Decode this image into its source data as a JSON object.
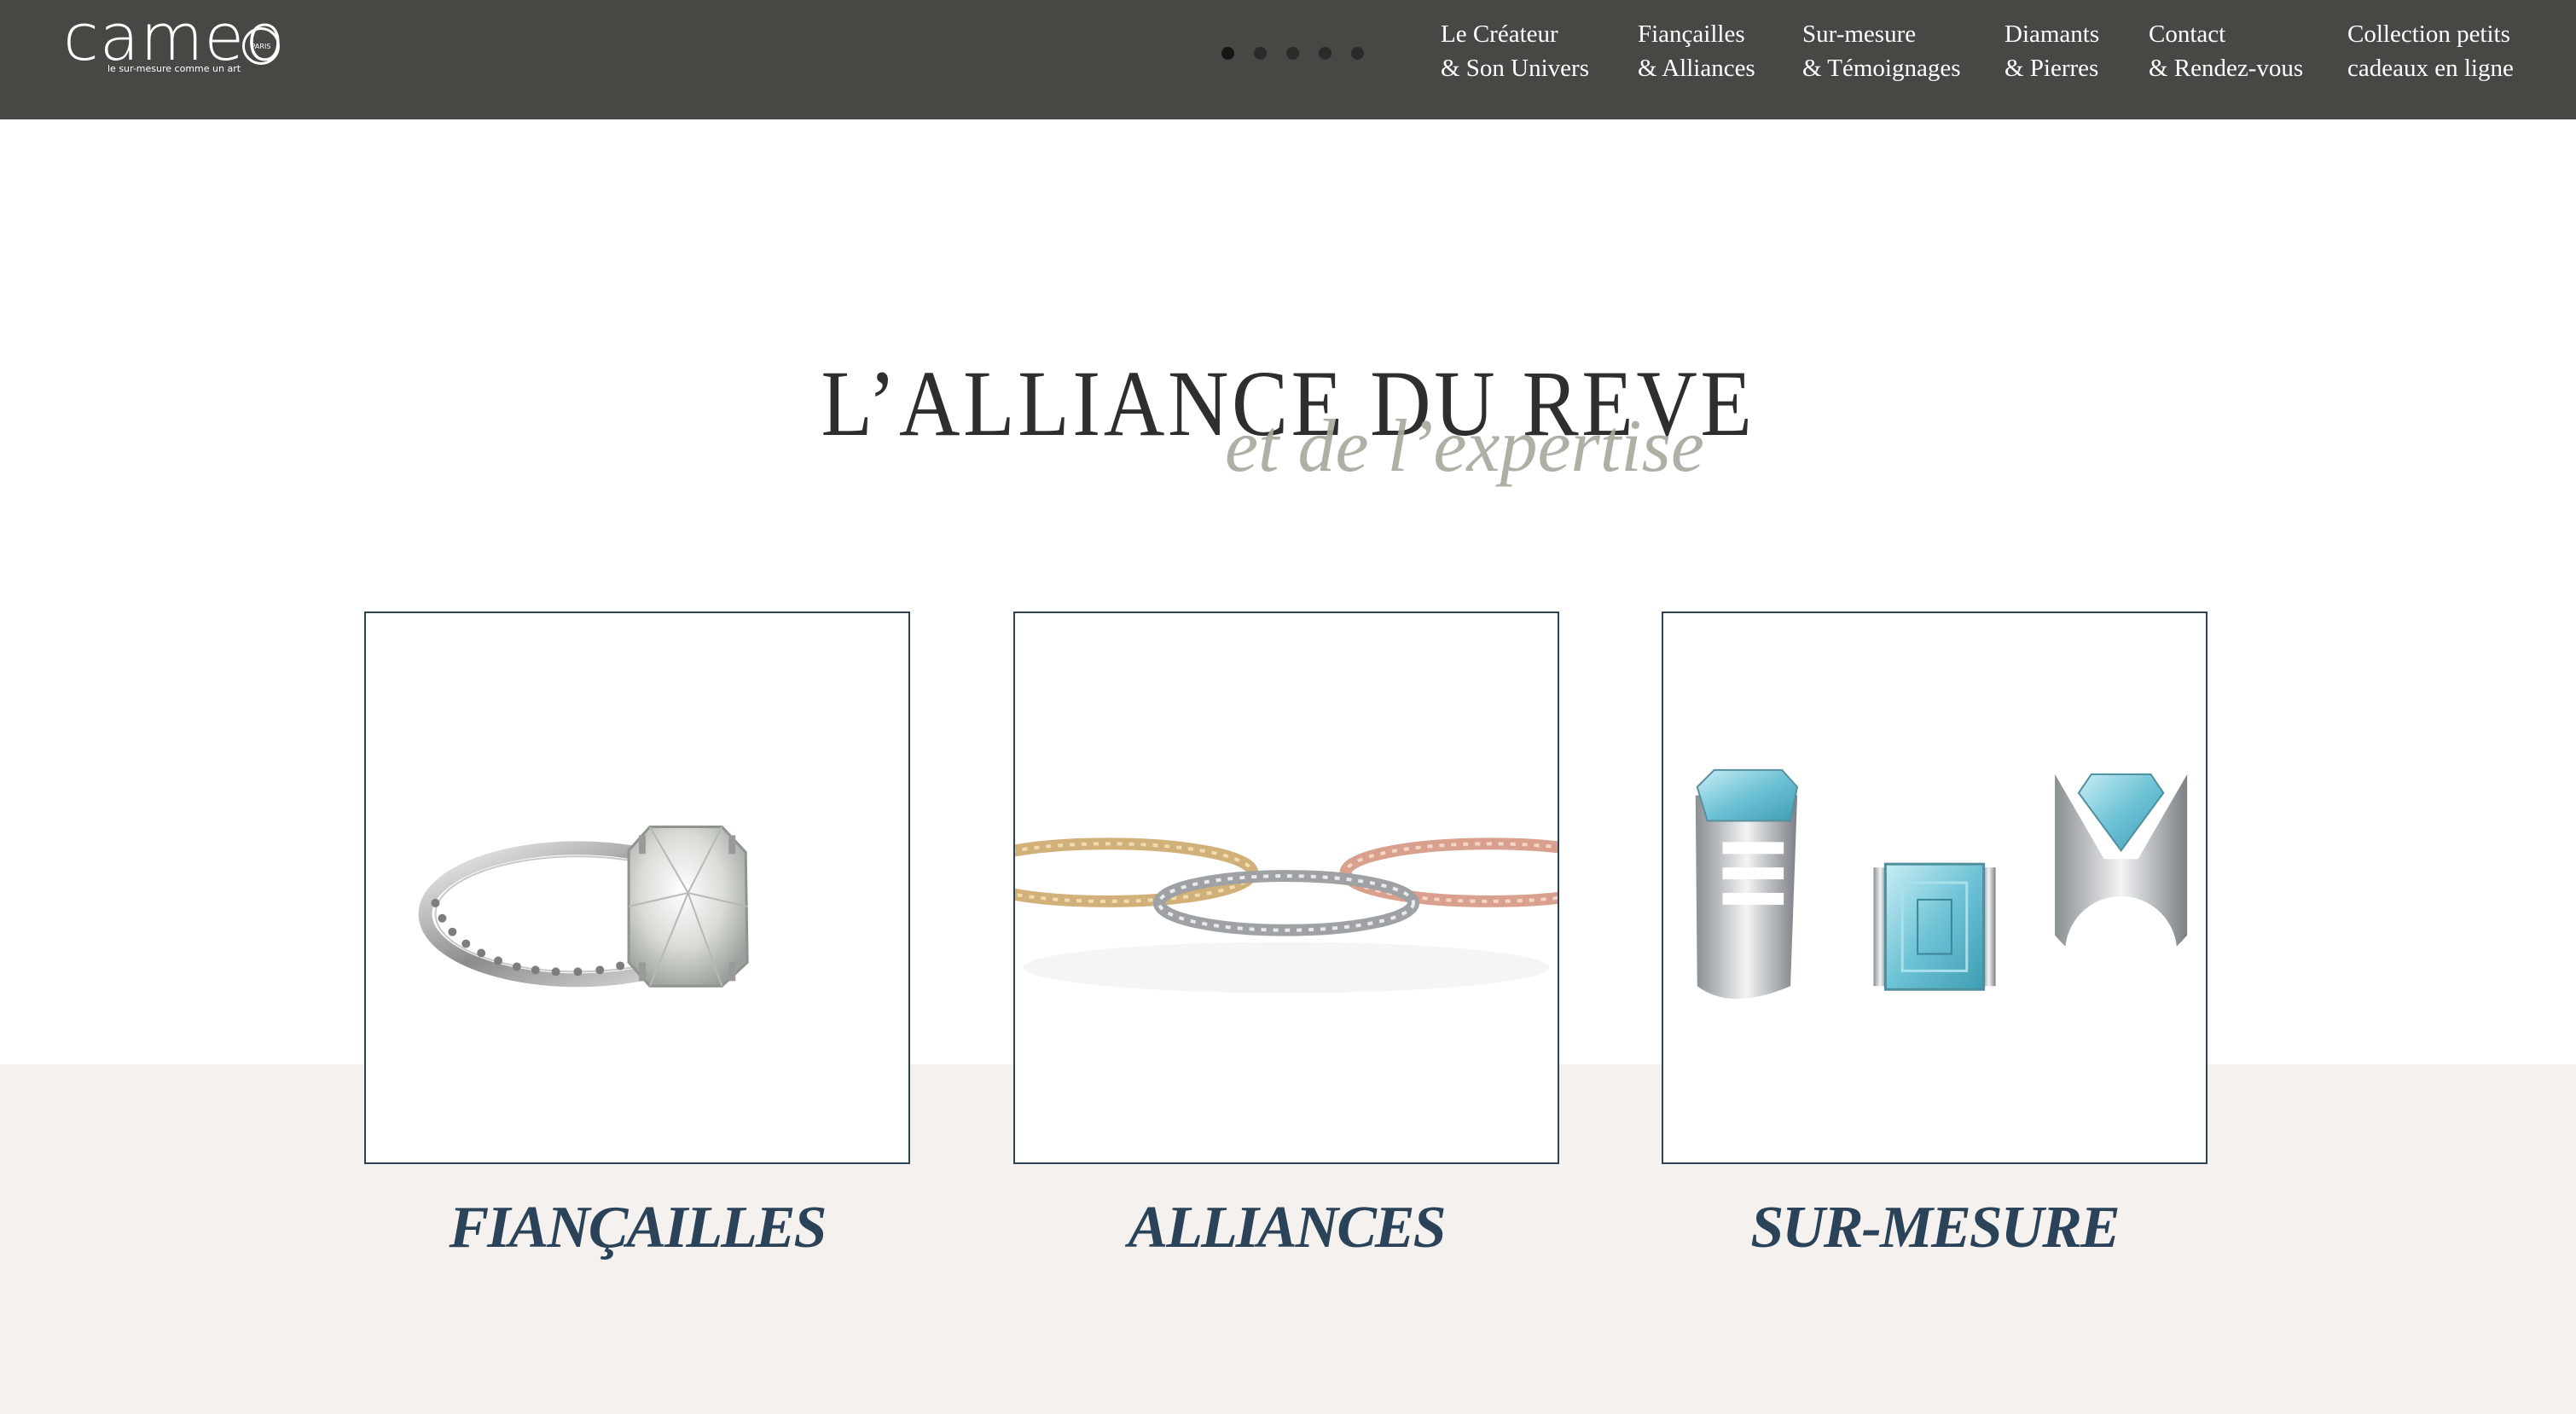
{
  "brand": {
    "logo_text": "cameo",
    "logo_badge": "PARIS",
    "tagline": "le sur-mesure comme un art"
  },
  "slider": {
    "dot_count": 5,
    "active_index": 0
  },
  "nav": [
    {
      "line1": "Le Créateur",
      "line2": "& Son Univers"
    },
    {
      "line1": "Fiançailles",
      "line2": "& Alliances"
    },
    {
      "line1": "Sur-mesure",
      "line2": "& Témoignages"
    },
    {
      "line1": "Diamants",
      "line2": "& Pierres"
    },
    {
      "line1": "Contact",
      "line2": "& Rendez-vous"
    },
    {
      "line1": "Collection petits",
      "line2": "cadeaux en ligne"
    }
  ],
  "hero": {
    "title": "L’ALLIANCE DU REVE",
    "subtitle": "et de l’expertise"
  },
  "cards": [
    {
      "label": "FIANÇAILLES",
      "image": "solitaire-diamond-ring"
    },
    {
      "label": "ALLIANCES",
      "image": "wedding-bands"
    },
    {
      "label": "SUR-MESURE",
      "image": "aquamarine-rings"
    }
  ],
  "colors": {
    "header_bg": "#464843",
    "accent_blue": "#2b4358",
    "subtitle_grey": "#a9aa9e",
    "band_beige": "#f5f1ef"
  }
}
